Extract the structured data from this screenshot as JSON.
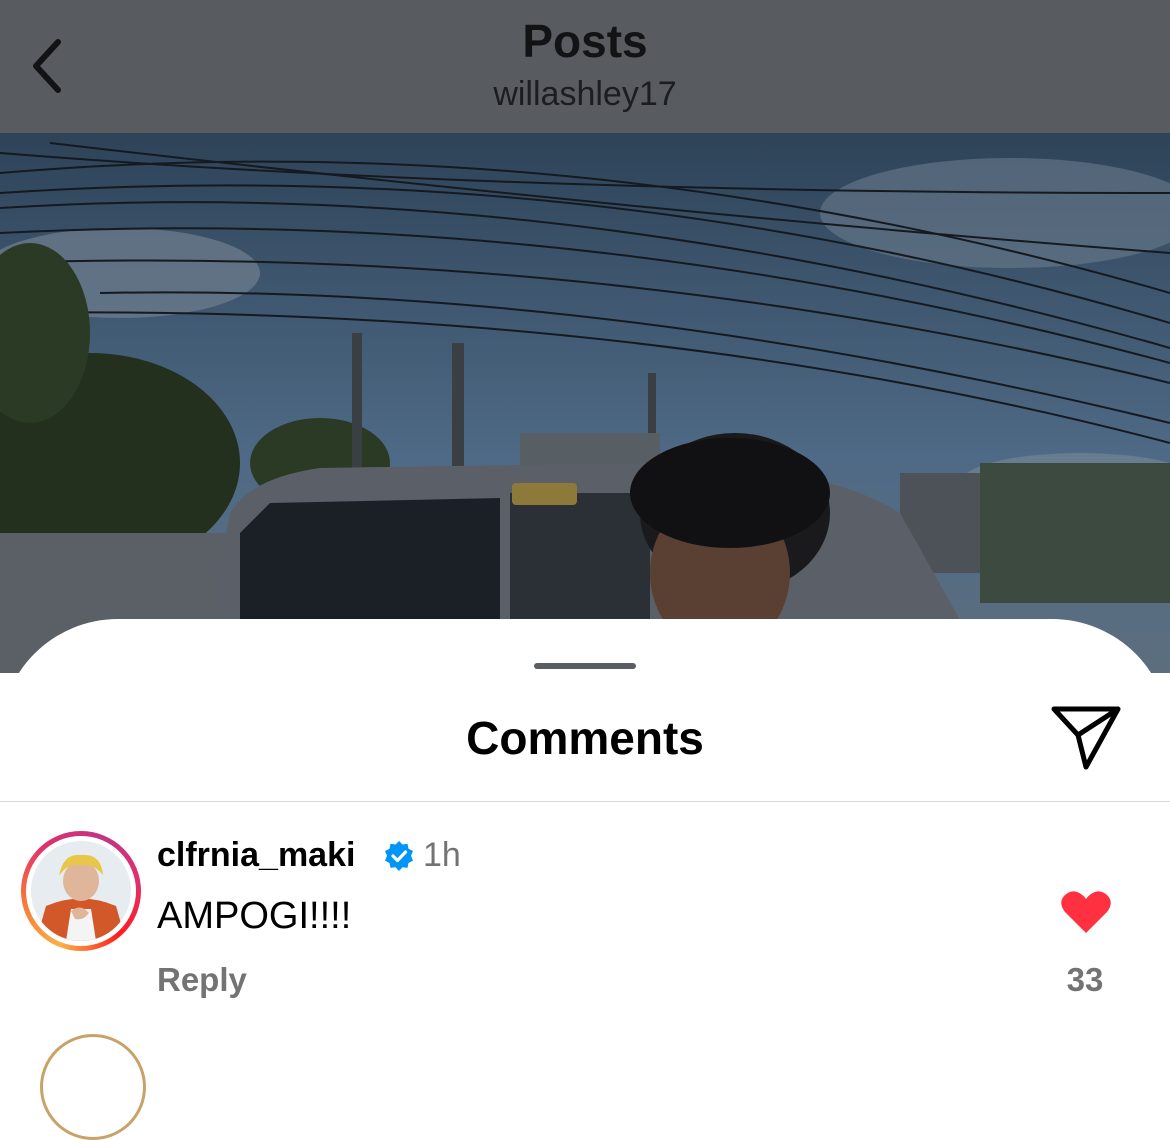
{
  "header": {
    "title": "Posts",
    "subtitle": "willashley17",
    "back_icon": "chevron-left-icon"
  },
  "post": {
    "image_description_icon": "post-photo"
  },
  "comments_sheet": {
    "title": "Comments",
    "share_icon": "send-icon"
  },
  "comments": [
    {
      "username": "clfrnia_maki",
      "verified": true,
      "time": "1h",
      "text": "AMPOGI!!!!",
      "reply_label": "Reply",
      "like_count": "33",
      "liked": true
    }
  ],
  "colors": {
    "like": "#ff3040",
    "verified": "#0095f6",
    "secondary_text": "#737373",
    "header_overlay": "#585c61"
  }
}
